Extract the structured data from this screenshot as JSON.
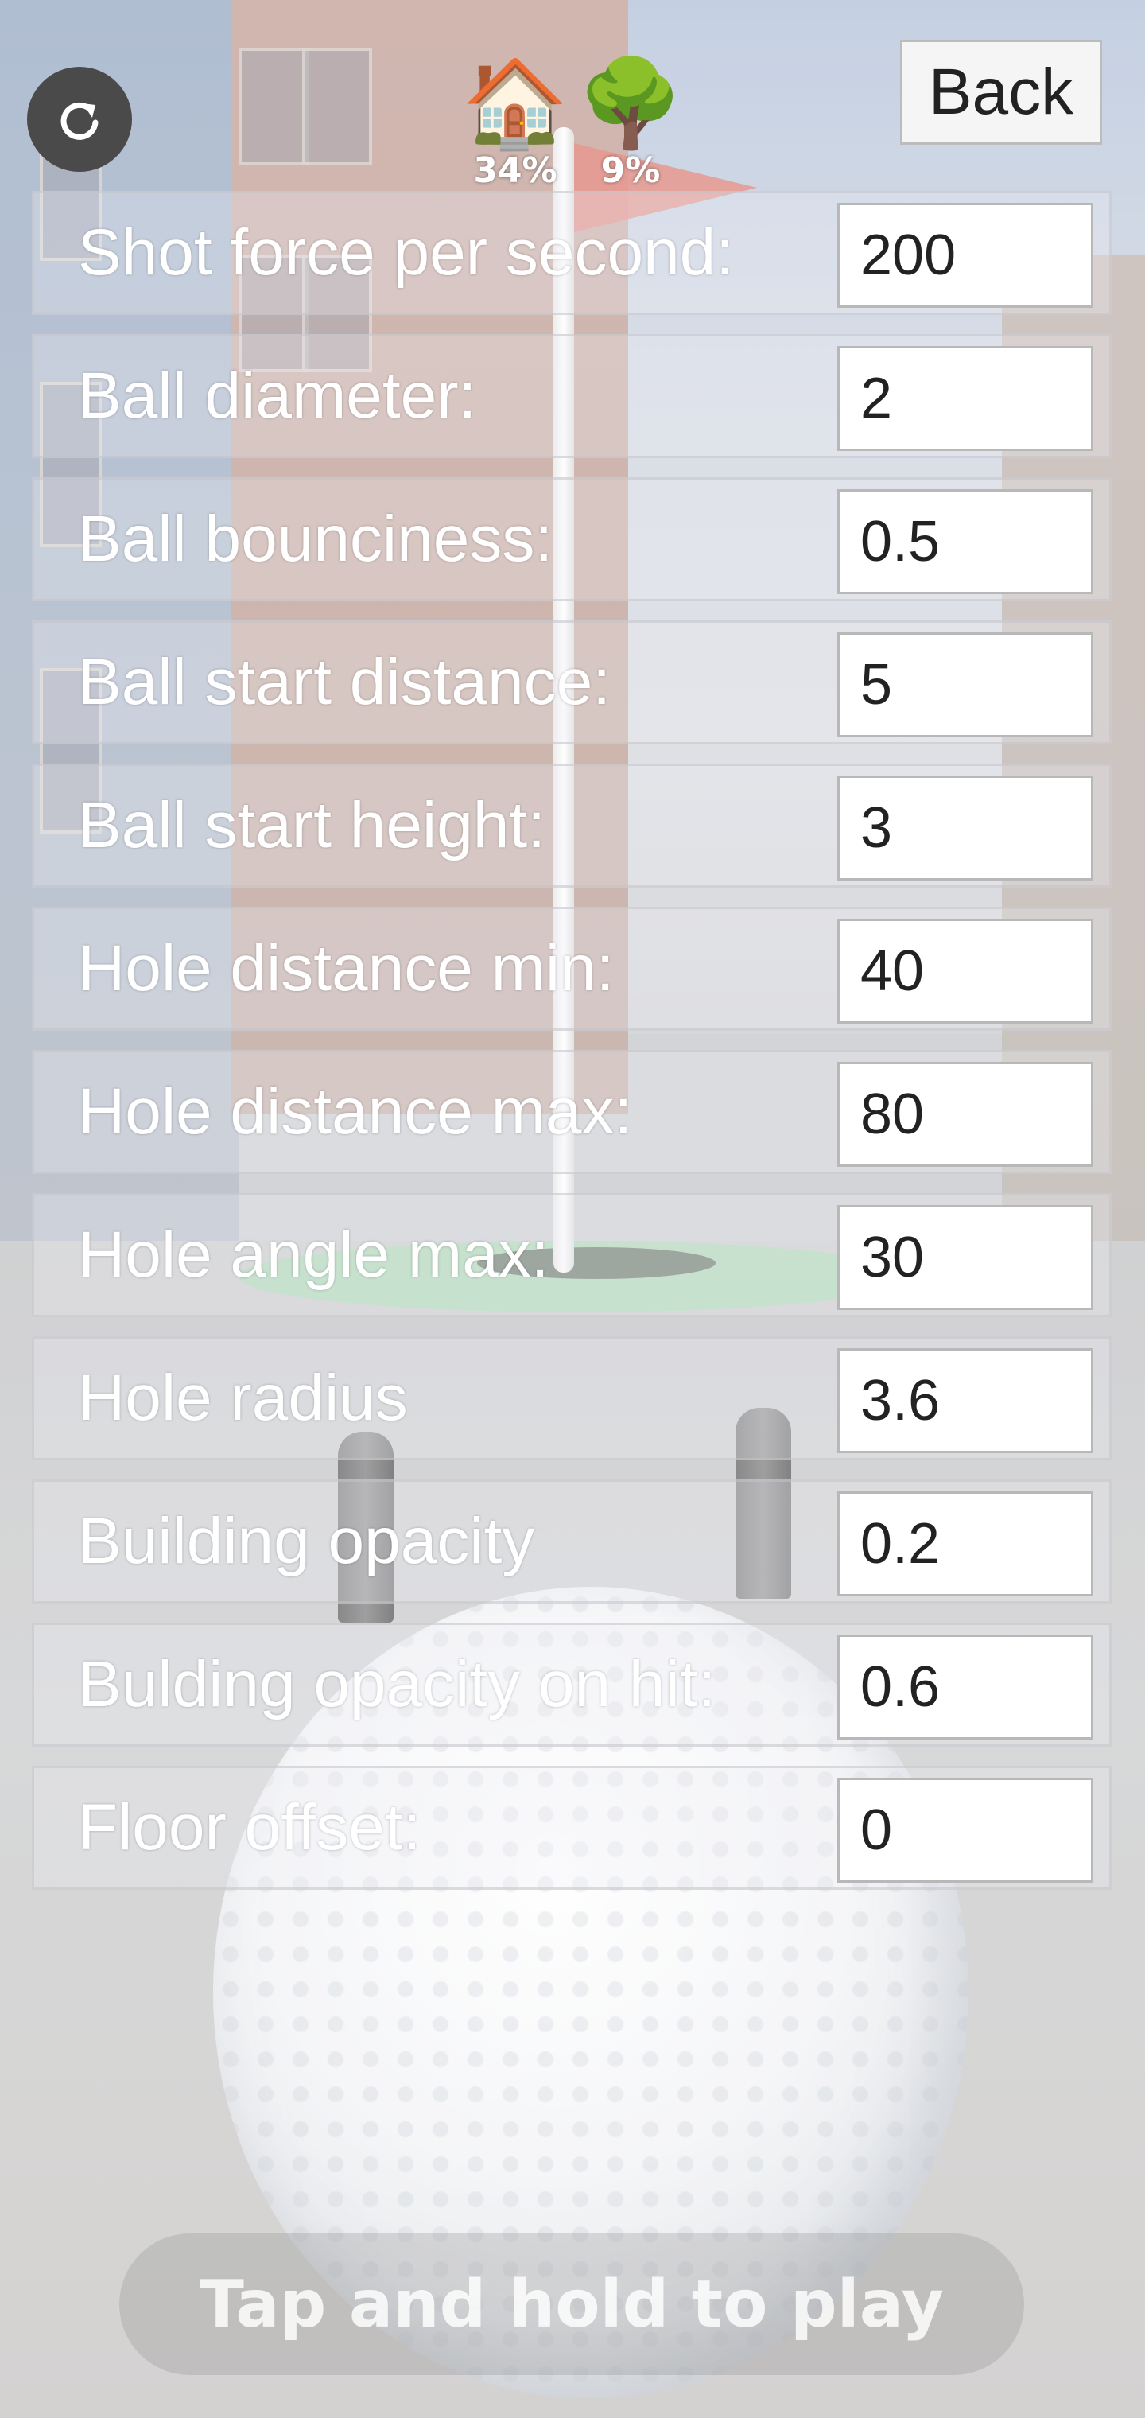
{
  "top_bar": {
    "reset_icon": "refresh-icon",
    "house_stat": {
      "icon": "🏠",
      "value": "34%"
    },
    "tree_stat": {
      "icon": "🌳",
      "value": "9%"
    },
    "back_label": "Back"
  },
  "settings": [
    {
      "label": "Shot force per second:",
      "value": "200"
    },
    {
      "label": "Ball diameter:",
      "value": "2"
    },
    {
      "label": "Ball bounciness:",
      "value": "0.5"
    },
    {
      "label": "Ball start distance:",
      "value": "5"
    },
    {
      "label": "Ball start height:",
      "value": "3"
    },
    {
      "label": "Hole distance min:",
      "value": "40"
    },
    {
      "label": "Hole distance max:",
      "value": "80"
    },
    {
      "label": "Hole angle max:",
      "value": "30"
    },
    {
      "label": "Hole radius",
      "value": "3.6"
    },
    {
      "label": "Building opacity",
      "value": "0.2"
    },
    {
      "label": "Bulding opacity on hit:",
      "value": "0.6"
    },
    {
      "label": "Floor offset:",
      "value": "0"
    }
  ],
  "hint": {
    "text": "Tap and hold to play"
  },
  "colors": {
    "flag": "#e2827a",
    "green": "#a0d7aa",
    "reset_button": "#4a4a4a"
  }
}
